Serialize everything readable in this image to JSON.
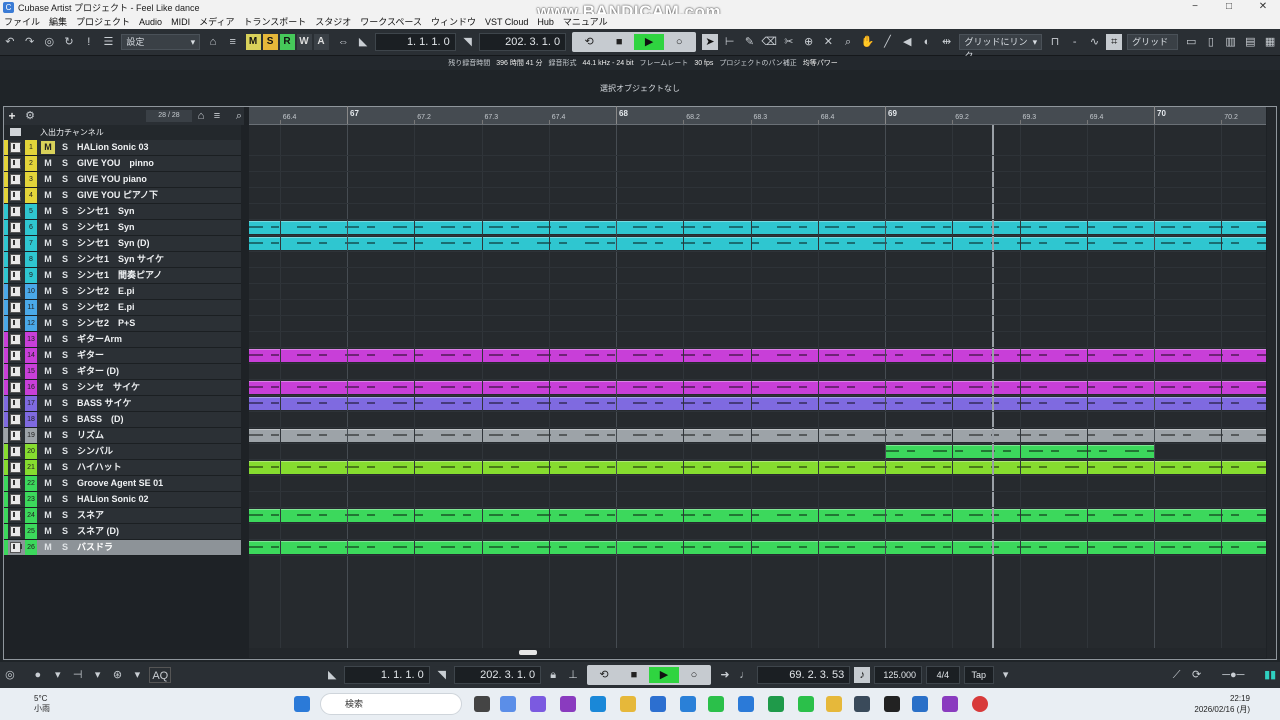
{
  "window": {
    "title": "Cubase Artist プロジェクト - Feel Like dance"
  },
  "watermark": "www.BANDICAM.com",
  "menu": [
    "ファイル",
    "編集",
    "プロジェクト",
    "Audio",
    "MIDI",
    "メディア",
    "トランスポート",
    "スタジオ",
    "ワークスペース",
    "ウィンドウ",
    "VST Cloud",
    "Hub",
    "マニュアル"
  ],
  "toolbar": {
    "preset": "設定",
    "msrw": [
      "M",
      "S",
      "R",
      "W",
      "A"
    ],
    "left_locator": "1. 1. 1.  0",
    "right_locator": "202. 3. 1.  0",
    "snap_mode": "グリッドにリンク",
    "grid_label": "グリッド"
  },
  "info": {
    "rec_time_label": "残り録音時間",
    "rec_time": "396 時間 41 分",
    "rec_format_label": "録音形式",
    "rec_format": "44.1 kHz - 24 bit",
    "frame_label": "フレームレート",
    "frame": "30 fps",
    "pan_label": "プロジェクトのパン補正",
    "pan": "均等パワー"
  },
  "selection_info": "選択オブジェクトなし",
  "tracklist": {
    "count": "28 / 28",
    "folder_name": "入出力チャンネル",
    "tracks": [
      {
        "num": "1",
        "name": "HALion Sonic 03",
        "color": "#e3d43a"
      },
      {
        "num": "2",
        "name": "GIVE YOU　pinno",
        "color": "#e3d43a"
      },
      {
        "num": "3",
        "name": "GIVE YOU piano",
        "color": "#e3d43a"
      },
      {
        "num": "4",
        "name": "GIVE YOU ピアノ下",
        "color": "#e3d43a"
      },
      {
        "num": "5",
        "name": "シンセ1　Syn",
        "color": "#2fc6d0"
      },
      {
        "num": "6",
        "name": "シンセ1　Syn",
        "color": "#2fc6d0"
      },
      {
        "num": "7",
        "name": "シンセ1　Syn (D)",
        "color": "#2fc6d0"
      },
      {
        "num": "8",
        "name": "シンセ1　Syn サイケ",
        "color": "#2fc6d0"
      },
      {
        "num": "9",
        "name": "シンセ1　間奏ピアノ",
        "color": "#2fc6d0"
      },
      {
        "num": "10",
        "name": "シンセ2　E.pi",
        "color": "#4aa8e8"
      },
      {
        "num": "11",
        "name": "シンセ2　E.pi",
        "color": "#4aa8e8"
      },
      {
        "num": "12",
        "name": "シンセ2　P+S",
        "color": "#4aa8e8"
      },
      {
        "num": "13",
        "name": "ギターArm",
        "color": "#c83fd8"
      },
      {
        "num": "14",
        "name": "ギター",
        "color": "#c83fd8"
      },
      {
        "num": "15",
        "name": "ギター (D)",
        "color": "#c83fd8"
      },
      {
        "num": "16",
        "name": "シンセ　サイケ",
        "color": "#c83fd8"
      },
      {
        "num": "17",
        "name": "BASS サイケ",
        "color": "#7f6ae0"
      },
      {
        "num": "18",
        "name": "BASS　(D)",
        "color": "#7f6ae0"
      },
      {
        "num": "19",
        "name": "リズム",
        "color": "#9da3a8"
      },
      {
        "num": "20",
        "name": "シンバル",
        "color": "#86dc2f"
      },
      {
        "num": "21",
        "name": "ハイハット",
        "color": "#86dc2f"
      },
      {
        "num": "22",
        "name": "Groove Agent SE 01",
        "color": "#3cd85c"
      },
      {
        "num": "23",
        "name": "HALion Sonic 02",
        "color": "#3cd85c"
      },
      {
        "num": "24",
        "name": "スネア",
        "color": "#3cd85c"
      },
      {
        "num": "25",
        "name": "スネア (D)",
        "color": "#3cd85c"
      },
      {
        "num": "26",
        "name": "バスドラ",
        "color": "#3cd85c"
      }
    ]
  },
  "ruler": {
    "bars": [
      "67",
      "68",
      "69",
      "70"
    ],
    "beats": [
      "66.4",
      "67.2",
      "67.3",
      "67.4",
      "68.2",
      "68.3",
      "68.4",
      "69.2",
      "69.3",
      "69.4",
      "70.2"
    ]
  },
  "parts": [
    {
      "track": "6",
      "color": "#2fc6d0"
    },
    {
      "track": "7",
      "color": "#2fc6d0"
    },
    {
      "track": "14",
      "color": "#c83fd8"
    },
    {
      "track": "16",
      "color": "#c83fd8"
    },
    {
      "track": "17",
      "color": "#7f6ae0"
    },
    {
      "track": "19",
      "color": "#9da3a8"
    },
    {
      "track": "20",
      "color": "#3cd85c"
    },
    {
      "track": "21",
      "color": "#86dc2f"
    },
    {
      "track": "24",
      "color": "#3cd85c"
    },
    {
      "track": "26",
      "color": "#3cd85c"
    }
  ],
  "bottom": {
    "left_locator": "1. 1. 1.  0",
    "right_locator": "202. 3. 1.  0",
    "position": "69. 2. 3. 53",
    "tempo": "125.000",
    "signature": "4/4",
    "tap": "Tap",
    "aq": "AQ"
  },
  "taskbar": {
    "temp": "5°C",
    "weather": "小雨",
    "search": "検索",
    "time": "22:19",
    "date": "2026/02/16 (月)"
  }
}
